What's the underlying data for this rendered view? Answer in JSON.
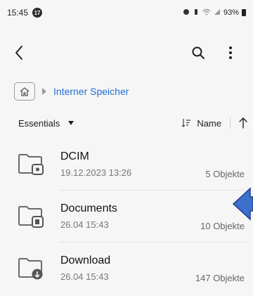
{
  "status_bar": {
    "time": "15:45",
    "notification_badge": "17",
    "battery": "93%"
  },
  "toolbar": {
    "back_icon": "back-arrow-icon",
    "search_icon": "search-icon",
    "more_icon": "more-vertical-icon"
  },
  "breadcrumb": {
    "location": "Interner Speicher"
  },
  "sort": {
    "filter_label": "Essentials",
    "sort_by": "Name"
  },
  "items": [
    {
      "name": "DCIM",
      "date": "19.12.2023 13:26",
      "count": "5 Objekte",
      "badge_icon": "camera-icon"
    },
    {
      "name": "Documents",
      "date": "26.04 15:43",
      "count": "10 Objekte",
      "badge_icon": "document-icon"
    },
    {
      "name": "Download",
      "date": "26.04 15:43",
      "count": "147 Objekte",
      "badge_icon": "download-icon"
    }
  ],
  "colors": {
    "accent": "#1f6fd6",
    "pointer_arrow": "#3d6fcc"
  }
}
